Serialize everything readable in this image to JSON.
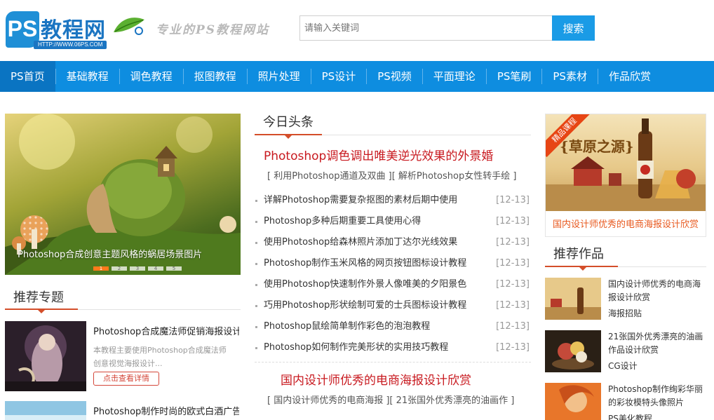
{
  "header": {
    "logo_ps": "PS",
    "logo_name": "教程网",
    "logo_url": "HTTP://WWW.06PS.COM",
    "slogan": "专业的PS教程网站",
    "search_placeholder": "请输入关键词",
    "search_button": "搜索"
  },
  "nav": {
    "items": [
      "PS首页",
      "基础教程",
      "调色教程",
      "抠图教程",
      "照片处理",
      "PS设计",
      "PS视频",
      "平面理论",
      "PS笔刷",
      "PS素材",
      "作品欣赏"
    ],
    "active_index": 0
  },
  "slider": {
    "caption": "Photoshop合成创意主题风格的蜗居场景图片",
    "dots": [
      "1",
      "2",
      "3",
      "4",
      "5"
    ],
    "active_dot": 0
  },
  "featured": {
    "title": "推荐专题",
    "items": [
      {
        "title": "Photoshop合成魔法师促销海报设计",
        "desc": "本教程主要使用Photoshop合成魔法师创意视觉海报设计...",
        "button": "点击查看详情"
      },
      {
        "title": "Photoshop制作时尚的欧式白酒广告"
      }
    ]
  },
  "today": {
    "title": "今日头条",
    "headline": "Photoshop调色调出唯美逆光效果的外景婚",
    "subline": "[ 利用Photoshop通道及双曲 ][ 解析Photoshop女性转手绘 ]",
    "news": [
      {
        "title": "详解Photoshop需要复杂抠图的素材后期中使用",
        "date": "[12-13]"
      },
      {
        "title": "Photoshop多种后期重要工具使用心得",
        "date": "[12-13]"
      },
      {
        "title": "使用Photoshop给森林照片添加丁达尔光线效果",
        "date": "[12-13]"
      },
      {
        "title": "Photoshop制作玉米风格的网页按钮图标设计教程",
        "date": "[12-13]"
      },
      {
        "title": "使用Photoshop快速制作外景人像唯美的夕阳景色",
        "date": "[12-13]"
      },
      {
        "title": "巧用Photoshop形状绘制可爱的士兵图标设计教程",
        "date": "[12-13]"
      },
      {
        "title": "Photoshop鼠绘简单制作彩色的泡泡教程",
        "date": "[12-13]"
      },
      {
        "title": "Photoshop如何制作完美形状的实用技巧教程",
        "date": "[12-13]"
      }
    ],
    "headline2": "国内设计师优秀的电商海报设计欣赏",
    "subline2": "[ 国内设计师优秀的电商海报 ][ 21张国外优秀漂亮的油画作 ]"
  },
  "ad": {
    "ribbon": "精品课程",
    "poster_title": "{草原之源}",
    "caption": "国内设计师优秀的电商海报设计欣赏"
  },
  "works": {
    "title": "推荐作品",
    "items": [
      {
        "title": "国内设计师优秀的电商海报设计欣赏",
        "tag": "海报招贴"
      },
      {
        "title": "21张国外优秀漂亮的油画作品设计欣赏",
        "tag": "CG设计"
      },
      {
        "title": "Photoshop制作绚彩华丽的彩妆模特头像照片",
        "tag": "PS美化教程"
      }
    ]
  },
  "colors": {
    "nav_bg": "#0e8de0",
    "nav_active": "#0a74c2",
    "search_btn": "#1a9be6",
    "headline_red": "#c8191f",
    "accent_orange": "#d44e2a"
  }
}
